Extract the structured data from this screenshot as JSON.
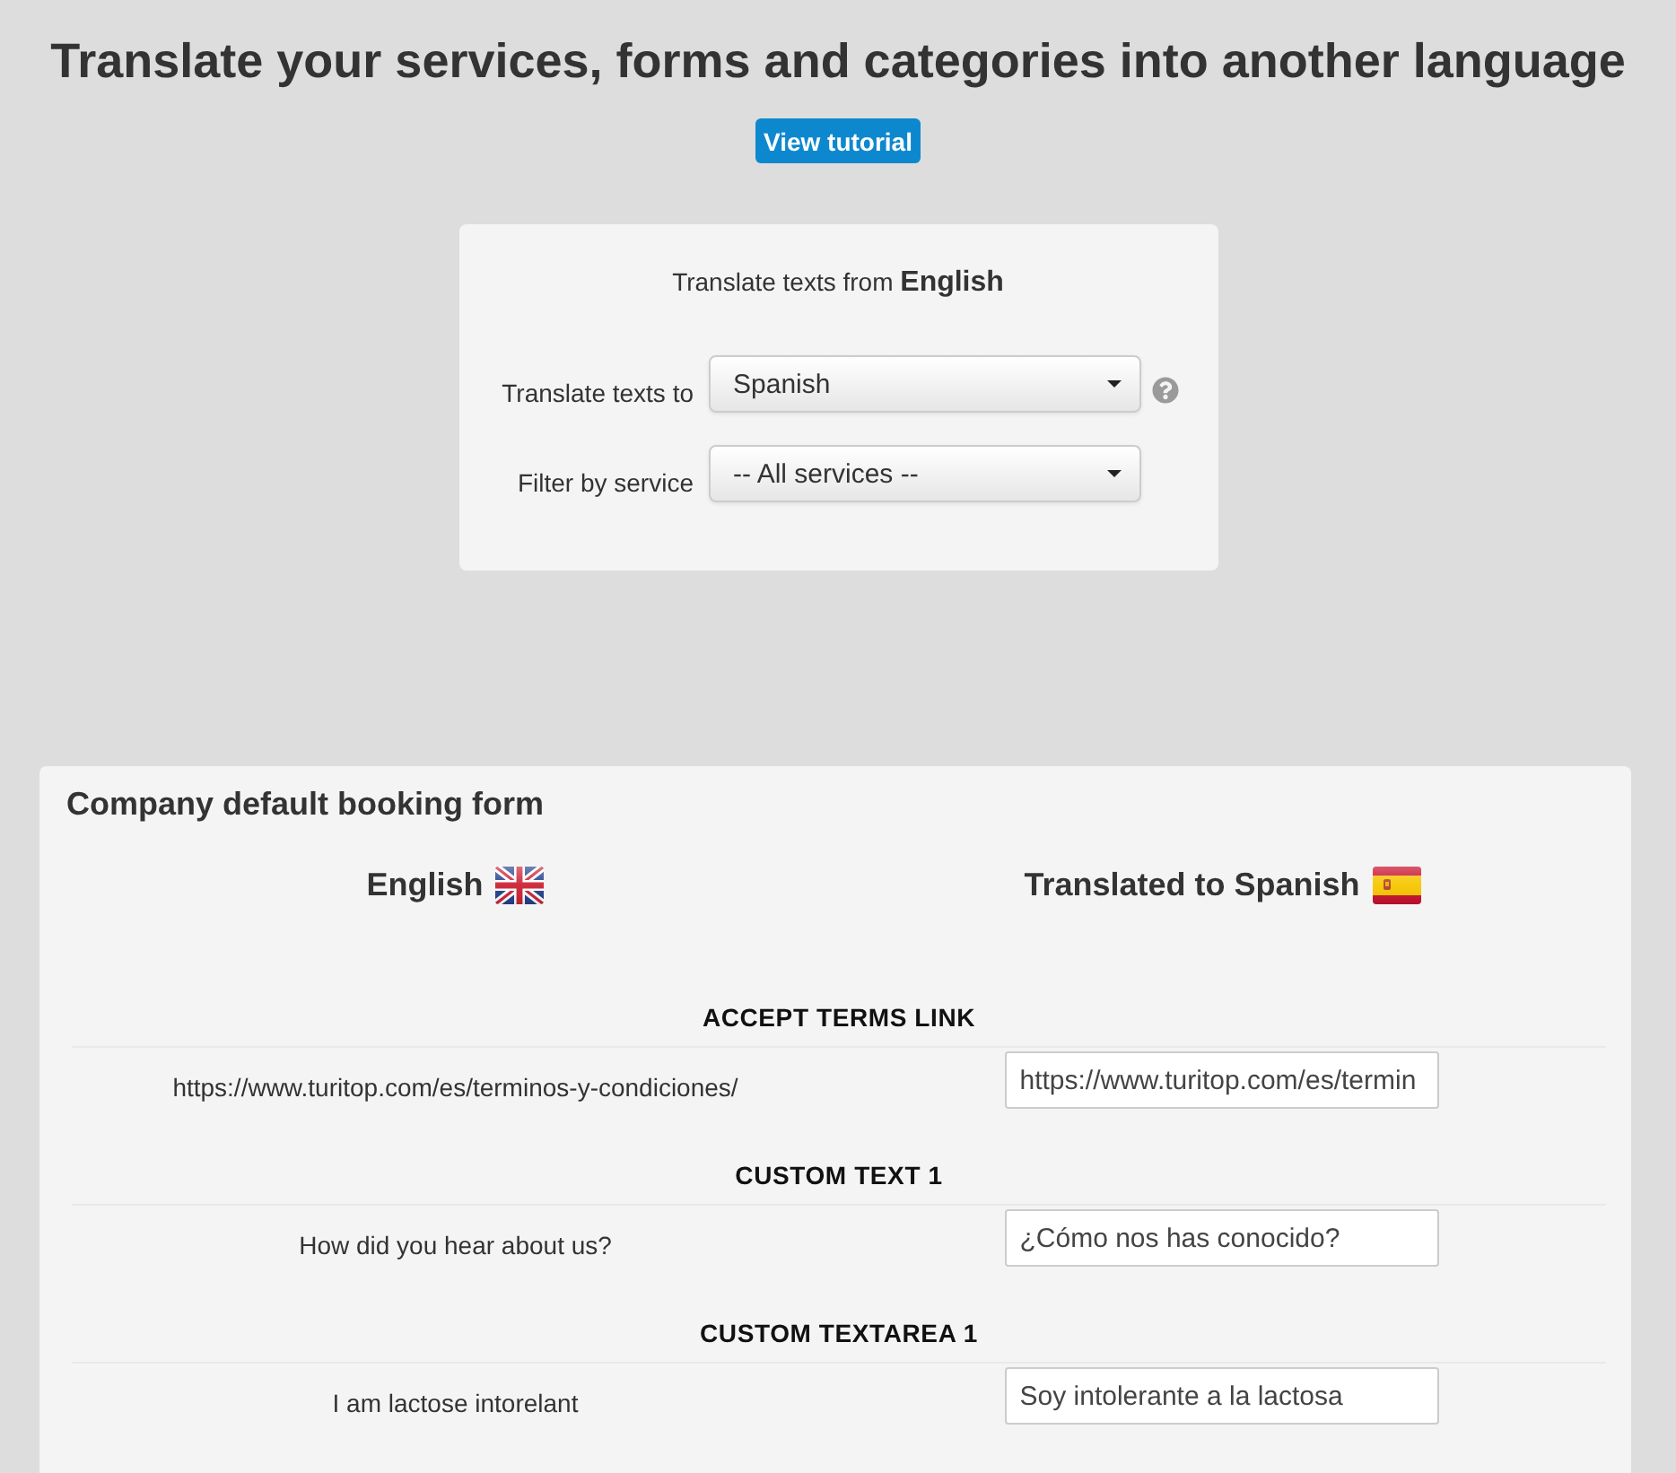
{
  "page": {
    "title": "Translate your services, forms and categories into another language",
    "tutorial_button": "View tutorial"
  },
  "settings": {
    "source_line": "Translate texts from **English**",
    "fields": [
      {
        "label": "Translate texts to",
        "value": "Spanish",
        "help": true
      },
      {
        "label": "Filter by service",
        "value": "-- All services --",
        "help": false
      }
    ]
  },
  "form": {
    "title": "Company default booking form",
    "columns": [
      {
        "label": "English",
        "kind": "uk"
      },
      {
        "label": "Translated to Spanish",
        "kind": "es"
      }
    ],
    "entries": [
      {
        "heading": "ACCEPT TERMS LINK",
        "source": "https://www.turitop.com/es/terminos-y-condiciones/",
        "translation": "https://www.turitop.com/es/termin"
      },
      {
        "heading": "CUSTOM TEXT 1",
        "source": "How did you hear about us?",
        "translation": "¿Cómo nos has conocido?"
      },
      {
        "heading": "CUSTOM TEXTAREA 1",
        "source": "I am lactose intorelant",
        "translation": "Soy intolerante a la lactosa"
      }
    ]
  }
}
